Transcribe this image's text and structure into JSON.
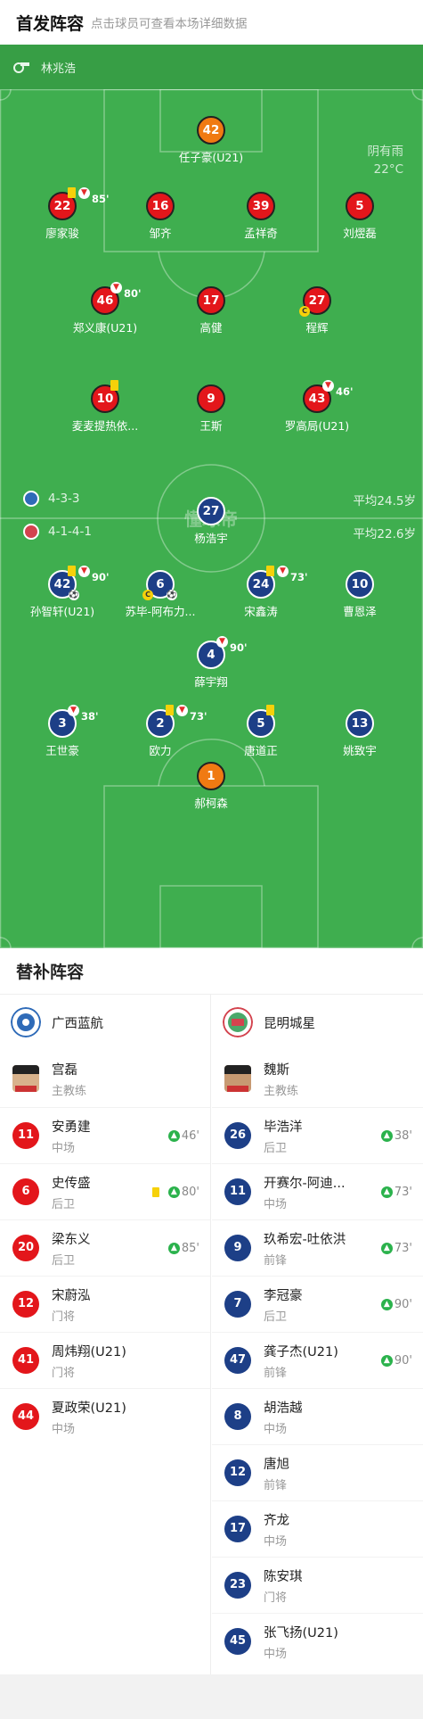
{
  "header": {
    "title": "首发阵容",
    "subtitle": "点击球员可查看本场详细数据"
  },
  "referee": {
    "icon": "whistle-icon",
    "name": "林兆浩"
  },
  "weather": {
    "condition": "阴有雨",
    "temperature": "22°C"
  },
  "watermark": "懂球帝",
  "home": {
    "formation": "4-3-3",
    "avg_age": "平均24.5岁",
    "players": [
      {
        "num": "42",
        "name": "任子豪(U21)",
        "color": "orange"
      },
      {
        "num": "22",
        "name": "廖家骏",
        "color": "red",
        "yellow": true,
        "sub_off": "85'"
      },
      {
        "num": "16",
        "name": "邹齐",
        "color": "red"
      },
      {
        "num": "39",
        "name": "孟祥奇",
        "color": "red"
      },
      {
        "num": "5",
        "name": "刘熤磊",
        "color": "red"
      },
      {
        "num": "46",
        "name": "郑义康(U21)",
        "color": "red",
        "sub_off": "80'"
      },
      {
        "num": "17",
        "name": "高健",
        "color": "red"
      },
      {
        "num": "27",
        "name": "程辉",
        "color": "red",
        "captain": true
      },
      {
        "num": "10",
        "name": "麦麦提热依...",
        "color": "red",
        "yellow": true
      },
      {
        "num": "9",
        "name": "王斯",
        "color": "red"
      },
      {
        "num": "43",
        "name": "罗高局(U21)",
        "color": "red",
        "sub_off": "46'"
      }
    ]
  },
  "away": {
    "formation": "4-1-4-1",
    "avg_age": "平均22.6岁",
    "players": [
      {
        "num": "27",
        "name": "杨浩宇",
        "color": "blue"
      },
      {
        "num": "42",
        "name": "孙智轩(U21)",
        "color": "blue",
        "yellow": true,
        "sub_off": "90'",
        "goal": true
      },
      {
        "num": "6",
        "name": "苏毕-阿布力...",
        "color": "blue",
        "captain": true,
        "goal": true
      },
      {
        "num": "24",
        "name": "宋鑫涛",
        "color": "blue",
        "yellow": true,
        "sub_off": "73'"
      },
      {
        "num": "10",
        "name": "曹恩泽",
        "color": "blue"
      },
      {
        "num": "4",
        "name": "薛宇翔",
        "color": "blue",
        "sub_off": "90'"
      },
      {
        "num": "3",
        "name": "王世豪",
        "color": "blue",
        "sub_off": "38'"
      },
      {
        "num": "2",
        "name": "欧力",
        "color": "blue",
        "yellow": true,
        "sub_off": "73'"
      },
      {
        "num": "5",
        "name": "唐道正",
        "color": "blue",
        "yellow": true
      },
      {
        "num": "13",
        "name": "姚致宇",
        "color": "blue"
      },
      {
        "num": "1",
        "name": "郝柯森",
        "color": "orange"
      }
    ]
  },
  "subs": {
    "title": "替补阵容",
    "home": {
      "team": "广西蓝航",
      "coach": {
        "name": "宫磊",
        "role": "主教练"
      },
      "players": [
        {
          "num": "11",
          "name": "安勇建",
          "pos": "中场",
          "in": "46'"
        },
        {
          "num": "6",
          "name": "史传盛",
          "pos": "后卫",
          "in": "80'",
          "yellow": true
        },
        {
          "num": "20",
          "name": "梁东义",
          "pos": "后卫",
          "in": "85'"
        },
        {
          "num": "12",
          "name": "宋蔚泓",
          "pos": "门将"
        },
        {
          "num": "41",
          "name": "周炜翔(U21)",
          "pos": "门将"
        },
        {
          "num": "44",
          "name": "夏政荣(U21)",
          "pos": "中场"
        }
      ]
    },
    "away": {
      "team": "昆明城星",
      "coach": {
        "name": "魏斯",
        "role": "主教练"
      },
      "players": [
        {
          "num": "26",
          "name": "毕浩洋",
          "pos": "后卫",
          "in": "38'"
        },
        {
          "num": "11",
          "name": "开赛尔-阿迪...",
          "pos": "中场",
          "in": "73'"
        },
        {
          "num": "9",
          "name": "玖希宏-吐依洪",
          "pos": "前锋",
          "in": "73'"
        },
        {
          "num": "7",
          "name": "李冠豪",
          "pos": "后卫",
          "in": "90'"
        },
        {
          "num": "47",
          "name": "龚子杰(U21)",
          "pos": "前锋",
          "in": "90'"
        },
        {
          "num": "8",
          "name": "胡浩越",
          "pos": "中场"
        },
        {
          "num": "12",
          "name": "唐旭",
          "pos": "前锋"
        },
        {
          "num": "17",
          "name": "齐龙",
          "pos": "中场"
        },
        {
          "num": "23",
          "name": "陈安琪",
          "pos": "门将"
        },
        {
          "num": "45",
          "name": "张飞扬(U21)",
          "pos": "中场"
        }
      ]
    }
  }
}
